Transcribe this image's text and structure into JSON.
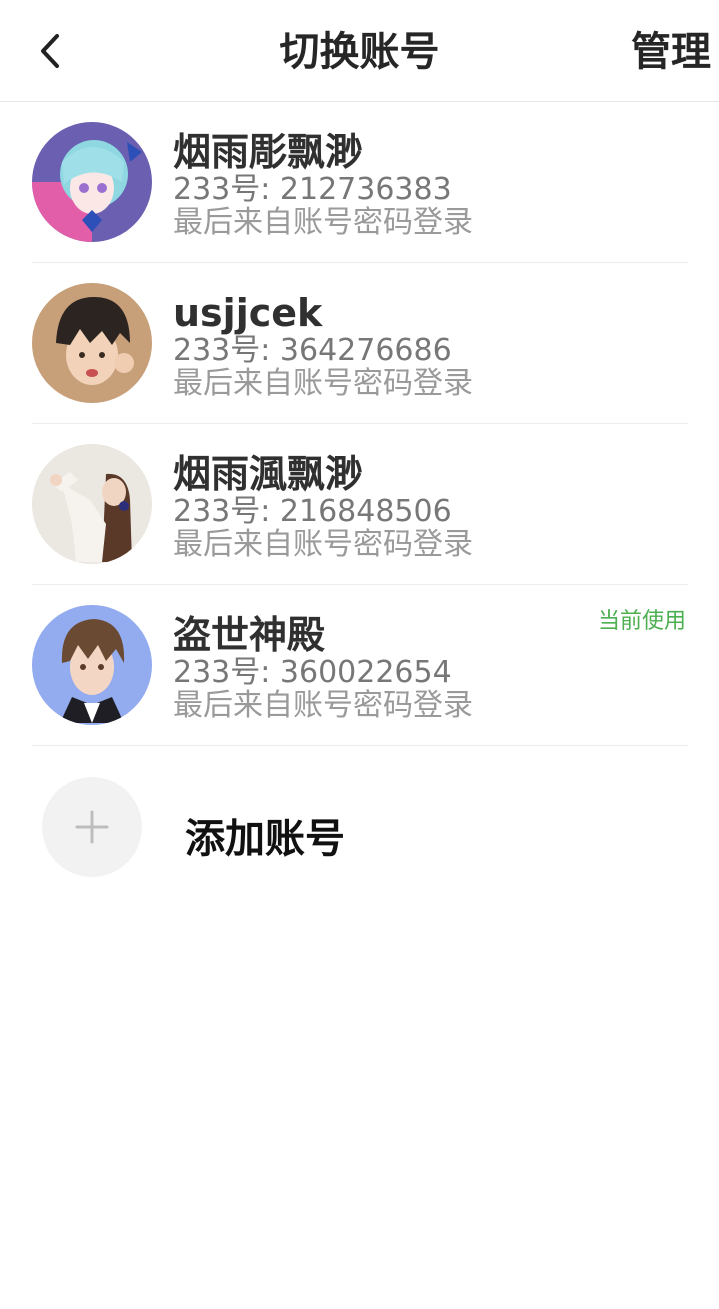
{
  "header": {
    "title": "切换账号",
    "manage_label": "管理"
  },
  "accounts": [
    {
      "name": "烟雨彫飘渺",
      "id_text": "233号: 212736383",
      "login_text": "最后来自账号密码登录",
      "current": false,
      "avatar_colors": [
        "#7fd0d8",
        "#3b2a6e"
      ]
    },
    {
      "name": "usjjcek",
      "id_text": "233号: 364276686",
      "login_text": "最后来自账号密码登录",
      "current": false,
      "avatar_colors": [
        "#c9a27e",
        "#2d2622"
      ]
    },
    {
      "name": "烟雨渢飘渺",
      "id_text": "233号: 216848506",
      "login_text": "最后来自账号密码登录",
      "current": false,
      "avatar_colors": [
        "#ece8e2",
        "#5b3a2c"
      ]
    },
    {
      "name": "盗世神殿",
      "id_text": "233号: 360022654",
      "login_text": "最后来自账号密码登录",
      "current": true,
      "current_label": "当前使用",
      "avatar_colors": [
        "#8fa6f0",
        "#6b4a33"
      ]
    }
  ],
  "add_account": {
    "label": "添加账号",
    "icon": "plus-icon"
  },
  "colors": {
    "current_badge": "#4caf50",
    "divider": "#ececec"
  }
}
